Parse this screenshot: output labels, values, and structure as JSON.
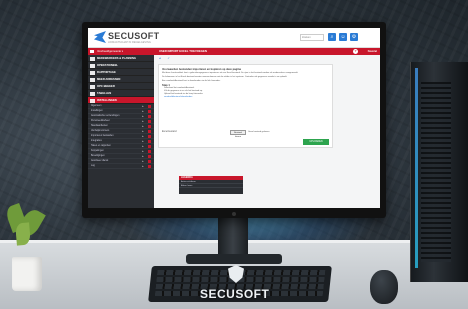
{
  "app": {
    "brand_name": "SECUSOFT",
    "brand_tagline": "LIDMAATSCHAP IN REGELGEVING",
    "search_placeholder": "Zoeken"
  },
  "sidebar": {
    "home_label": "Voorbeeldgemeente ▾",
    "main_items": [
      {
        "label": "MEDEWERKERS & PLANNING",
        "active": false
      },
      {
        "label": "OPERATIONEEL",
        "active": false
      },
      {
        "label": "RAPPORTAGE",
        "active": false
      },
      {
        "label": "MEER ADRESSEN",
        "active": false
      },
      {
        "label": "OPC BEHEER",
        "active": false
      },
      {
        "label": "TABELLEN",
        "active": false
      },
      {
        "label": "INSTELLINGEN",
        "active": true
      }
    ],
    "sub_items": [
      "Algemeen",
      "Instellingen",
      "Automatische verzendingen",
      "Personeelsbeheer",
      "Standaardtexten",
      "Verdwijnnummers",
      "Importeren bestanden",
      "Integraties",
      "Taken en rapporten",
      "Koppelingen",
      "Beveiligingen",
      "Autoriseer dienst",
      "Log"
    ]
  },
  "main": {
    "header_title": "USER IMPORT EXCEL TOEVOEGEN",
    "favorite_label": "Favoriet",
    "crumbs": [
      "◂",
      "✓"
    ],
    "card": {
      "title": "Voorwaarden bestanden importeren en kopiëren op deze pagina",
      "paragraphs": [
        "Met deze functionaliteit kunt u gebruikersgegevens importeren uit een Excel-bestand. De rijen in het bestand worden als medewerkers aangemaakt.",
        "De kolommen in het Excel-bestand moeten overeenkomen met de velden in het systeem. Controleer de gegevens voordat u ze uploadt.",
        "Een voorbeeldbestand kunt u downloaden via de link hieronder."
      ],
      "step_title": "Stap 1",
      "steps": [
        "Download het voorbeeldbestand.",
        "Vul de gegevens in en sla het bestand op.",
        "Upload het bestand via de knop hieronder."
      ],
      "link_text": "voorbeeldbestand downloaden",
      "file_label": "Excel-bestand",
      "file_button": "Bestand kiezen",
      "file_none": "Geen bestand gekozen",
      "upload_button": "UPLOADEN"
    },
    "legend": {
      "title": "LEGENDA",
      "rows": [
        "Acties zichtbaar",
        "Alleen lezen"
      ]
    }
  },
  "keyboard_brand": "SECUSOFT",
  "colors": {
    "accent": "#c8162b",
    "brand_blue": "#2a7bd5",
    "sidebar": "#2b2e33",
    "success": "#2da44e"
  }
}
